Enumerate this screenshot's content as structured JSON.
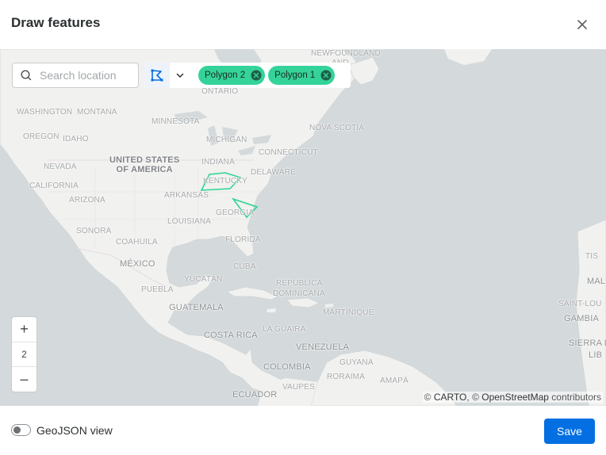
{
  "dialog": {
    "title": "Draw features",
    "close_icon": "close-icon"
  },
  "map": {
    "search": {
      "placeholder": "Search location",
      "value": "",
      "icon": "search-icon"
    },
    "draw_tool": {
      "icon": "polygon-draw-icon",
      "dropdown_icon": "chevron-down-icon",
      "accent": "#036fe2"
    },
    "chips": [
      {
        "label": "Polygon 2",
        "remove_icon": "close-circle-icon"
      },
      {
        "label": "Polygon 1",
        "remove_icon": "close-circle-icon"
      }
    ],
    "chip_color": "#34d399",
    "polygon_color": "#2dd492",
    "zoom": {
      "in": "+",
      "level": "2",
      "out": "–"
    },
    "attribution": {
      "prefix": "© ",
      "carto": "CARTO",
      "sep": ", © ",
      "osm": "OpenStreetMap",
      "suffix": " contributors"
    },
    "labels": {
      "newfoundland": "NEWFOUNDLAND",
      "and": "AND",
      "ontario": "ONTARIO",
      "washington": "WASHINGTON",
      "montana": "MONTANA",
      "minnesota": "MINNESOTA",
      "nova_scotia": "NOVA SCOTIA",
      "oregon": "OREGON",
      "idaho": "IDAHO",
      "michigan": "MICHIGAN",
      "connecticut": "CONNECTICUT",
      "united_states": "UNITED STATES",
      "of_america": "OF AMERICA",
      "nevada": "NEVADA",
      "indiana": "INDIANA",
      "delaware": "DELAWARE",
      "california": "CALIFORNIA",
      "kentucky": "KENTUCKY",
      "arizona": "ARIZONA",
      "arkansas": "ARKANSAS",
      "louisiana": "LOUISIANA",
      "georgia": "GEORGIA",
      "sonora": "SONORA",
      "florida": "FLORIDA",
      "coahuila": "COAHUILA",
      "mexico": "MÉXICO",
      "cuba": "CUBA",
      "puebla": "PUEBLA",
      "yucatan": "YUCATÁN",
      "republica": "REPÚBLICA",
      "dominicana": "DOMINICANA",
      "guatemala": "GUATEMALA",
      "martinique": "MARTINIQUE",
      "la_guaira": "LA GUAIRA",
      "costa_rica": "COSTA RICA",
      "venezuela": "VENEZUELA",
      "colombia": "COLOMBIA",
      "guyana": "GUYANA",
      "roraima": "RORAIMA",
      "amapa": "AMAPÁ",
      "ecuador": "ECUADOR",
      "vaupes": "VAUPES",
      "tis": "TIS",
      "mal": "MAL",
      "saint_lou": "SAINT-LOU",
      "gambia": "GAMBIA",
      "sierra_l": "SIERRA L",
      "lib": "LIB"
    }
  },
  "footer": {
    "toggle_label": "GeoJSON view",
    "toggle_on": false,
    "save_label": "Save",
    "accent": "#036fe2"
  }
}
